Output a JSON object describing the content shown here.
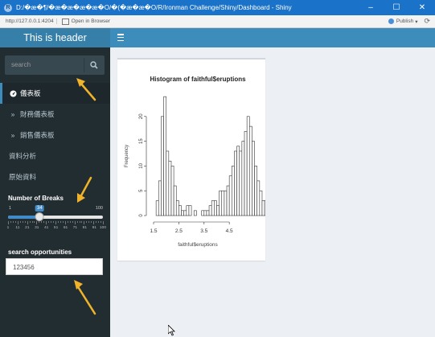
{
  "window": {
    "title": "D:/�æ�¶/�æ�æ�æ�æ�O/�(�æ�æ�O/R/Ironman Challenge/Shiny/Dashboard - Shiny",
    "icon_label": "R"
  },
  "toolbar": {
    "url": "http://127.0.0.1:4204",
    "open_browser_label": "Open in Browser",
    "publish_label": "Publish"
  },
  "header": {
    "title": "This is header"
  },
  "sidebar": {
    "search_placeholder": "search",
    "menu": [
      {
        "label": "儀表板",
        "icon": "dashboard-icon",
        "active": true
      },
      {
        "label": "財務儀表板",
        "icon": "double-chevron-right-icon",
        "active": false
      },
      {
        "label": "銷售儀表板",
        "icon": "double-chevron-right-icon",
        "active": false
      },
      {
        "label": "資料分析",
        "icon": "",
        "active": false
      },
      {
        "label": "原始資料",
        "icon": "",
        "active": false
      }
    ],
    "slider": {
      "label": "Number of Breaks",
      "min": 1,
      "max": 100,
      "value": 34,
      "min_label": "1",
      "max_label": "100",
      "value_label": "34",
      "tick_labels": [
        "1",
        "11",
        "21",
        "31",
        "41",
        "51",
        "61",
        "71",
        "81",
        "91",
        "100"
      ]
    },
    "opportunities": {
      "label": "search opportunities",
      "value": "123456"
    }
  },
  "chart_data": {
    "type": "bar",
    "title": "Histogram of faithful$eruptions",
    "xlabel": "faithful$eruptions",
    "ylabel": "Frequency",
    "xlim": [
      1.5,
      5.1
    ],
    "ylim": [
      0,
      25
    ],
    "x_ticks": [
      "1.5",
      "2.5",
      "3.5",
      "4.5"
    ],
    "x_tick_values": [
      1.5,
      2.5,
      3.5,
      4.5
    ],
    "y_ticks": [
      "0",
      "5",
      "10",
      "15",
      "20"
    ],
    "y_tick_values": [
      0,
      5,
      10,
      15,
      20
    ],
    "bin_start": 1.6,
    "bin_width": 0.1,
    "values": [
      3,
      7,
      20,
      24,
      13,
      11,
      10,
      6,
      3,
      2,
      1,
      1,
      2,
      2,
      0,
      1,
      0,
      0,
      1,
      1,
      1,
      2,
      3,
      3,
      2,
      5,
      5,
      5,
      6,
      8,
      10,
      13,
      14,
      13,
      15,
      17,
      20,
      18,
      15,
      10,
      7,
      5,
      3,
      3,
      1
    ]
  },
  "colors": {
    "header_logo": "#367fa9",
    "header_bar": "#3c8dbc",
    "sidebar": "#222d32",
    "content_bg": "#ecf0f5",
    "annotation_arrow": "#f0b32a"
  }
}
